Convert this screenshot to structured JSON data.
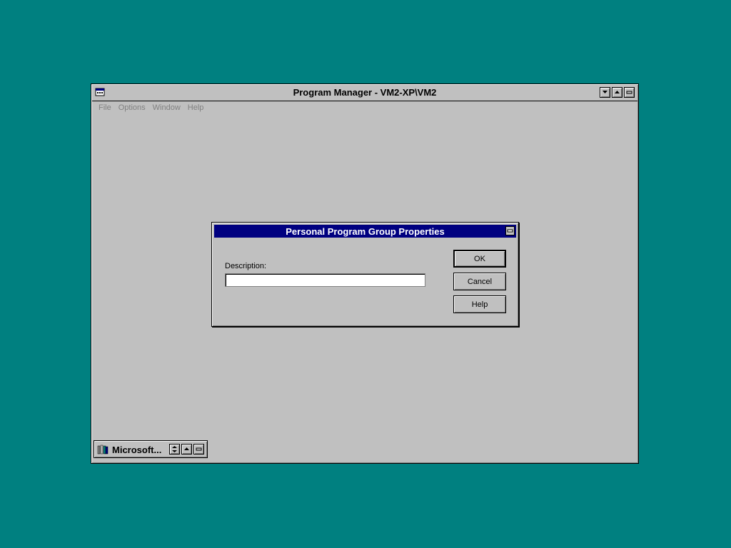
{
  "program_manager": {
    "title": "Program Manager - VM2-XP\\VM2",
    "menu": [
      "File",
      "Options",
      "Window",
      "Help"
    ],
    "icons": {
      "system_menu": "program-manager-icon",
      "minimize": "triangle-down-icon",
      "maximize": "triangle-up-icon",
      "restore": "restore-icon"
    }
  },
  "dialog": {
    "title": "Personal Program Group Properties",
    "description_label": "Description:",
    "description_value": "",
    "buttons": {
      "ok": "OK",
      "cancel": "Cancel",
      "help": "Help"
    }
  },
  "minimized_group": {
    "label": "Microsoft..."
  },
  "colors": {
    "desktop": "#008080",
    "window": "#c0c0c0",
    "active_title": "#000080"
  }
}
